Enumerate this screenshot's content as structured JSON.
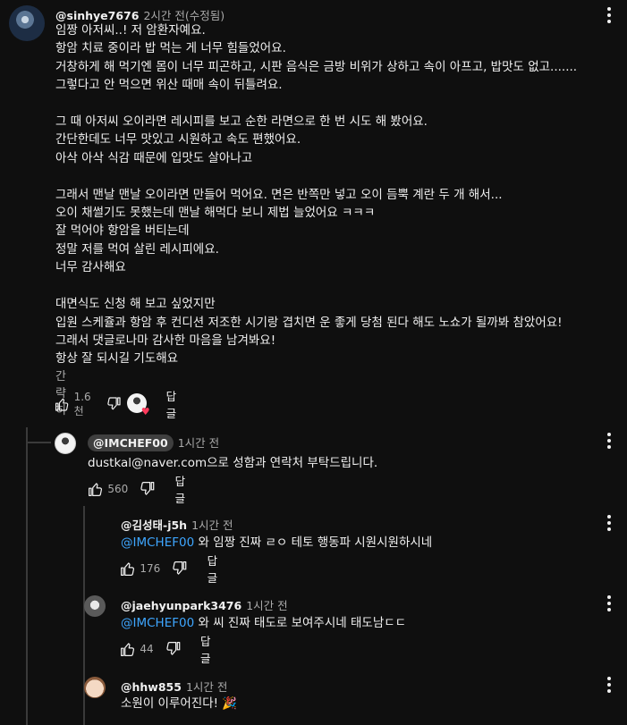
{
  "main": {
    "author": "@sinhye7676",
    "time": "2시간 전(수정됨)",
    "text": "임짱 아저씨..! 저 암환자예요.\n항암 치료 중이라 밥 먹는 게 너무 힘들었어요.\n거창하게 해 먹기엔 몸이 너무 피곤하고, 시판 음식은 금방 비위가 상하고 속이 아프고, 밥맛도 없고.......\n그렇다고 안 먹으면 위산 때매 속이 뒤틀려요.\n\n그 때 아저씨 오이라면 레시피를 보고 순한 라면으로 한 번 시도 해 봤어요.\n간단한데도 너무 맛있고 시원하고 속도 편했어요.\n아삭 아삭 식감 때문에 입맛도 살아나고\n\n그래서 맨날 맨날 오이라면 만들어 먹어요. 면은 반쪽만 넣고 오이 듬뿍 계란 두 개 해서...\n오이 채썰기도 못했는데 맨날 해먹다 보니 제법 늘었어요 ㅋㅋㅋ\n잘 먹어야 항암을 버티는데\n정말 저를 먹여 살린 레시피에요.\n너무 감사해요\n\n대면식도 신청 해 보고 싶었지만\n입원 스케쥴과 항암 후 컨디션 저조한 시기랑 겹치면 운 좋게 당첨 된다 해도 노쇼가 될까봐 참았어요!\n그래서 댓글로나마 감사한 마음을 남겨봐요!\n항상 잘 되시길 기도해요",
    "more_label": "간략히",
    "likes": "1.6천",
    "reply_label": "답글"
  },
  "replies": [
    {
      "author": "@IMCHEF00",
      "time": "1시간 전",
      "mention": "",
      "text": "dustkal@naver.com으로 성함과 연락처 부탁드립니다.",
      "likes": "560",
      "reply_label": "답글"
    },
    {
      "author": "@김성태-j5h",
      "time": "1시간 전",
      "mention": "@IMCHEF00",
      "text": " 와 임짱 진짜 ㄹㅇ 테토 행동파 시원시원하시네",
      "likes": "176",
      "reply_label": "답글"
    },
    {
      "author": "@jaehyunpark3476",
      "time": "1시간 전",
      "mention": "@IMCHEF00",
      "text": " 와 씨 진짜 태도로 보여주시네 태도남ㄷㄷ",
      "likes": "44",
      "reply_label": "답글"
    },
    {
      "author": "@hhw855",
      "time": "1시간 전",
      "mention": "",
      "text": "소원이 이루어진다! 🎉",
      "likes": "",
      "reply_label": ""
    }
  ],
  "icons": {
    "like": "thumbs-up-icon",
    "dislike": "thumbs-down-icon",
    "menu": "more-vert-icon",
    "creator_heart": "creator-heart-icon"
  },
  "colors": {
    "background": "#0f0f0f",
    "text": "#f1f1f1",
    "secondary": "#aaaaaa",
    "mention": "#3ea6ff",
    "heart": "#ff3b5c"
  }
}
